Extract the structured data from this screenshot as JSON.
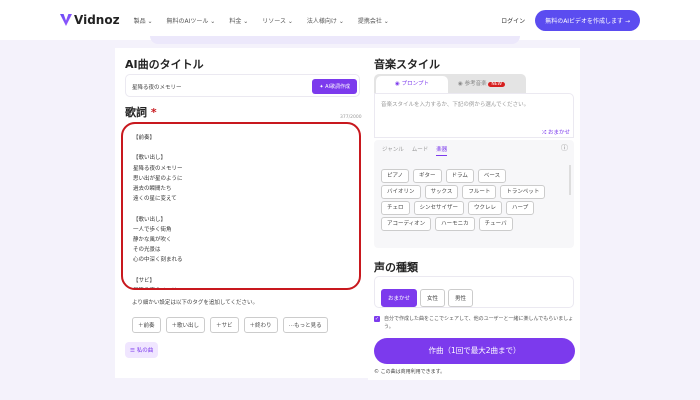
{
  "header": {
    "logo": "Vidnoz",
    "nav": [
      "製品",
      "無料のAIツール",
      "料金",
      "リソース",
      "法人様向け",
      "提携会社"
    ],
    "login": "ログイン",
    "cta": "無料のAIビデオを作成します →"
  },
  "left": {
    "title_heading": "AI曲のタイトル",
    "title_value": "星降る夜のメモリー",
    "ai_lyrics_button": "✦ AI歌詞作成",
    "lyrics_heading": "歌詞",
    "required_mark": "*",
    "counter": "377/2000",
    "lyrics": "【前奏】\n\n【歌い出し】\n星降る夜のメモリー\n思い出が星のように\n過去の瞬間たち\n遠くの星に変えて\n\n【歌い出し】\n一人で歩く街角\n静かな風が吹く\nその光景は\n心の中深く刻まれる\n\n【サビ】\n星降る夜のメモリー",
    "tag_hint": "より細かい設定は以下のタグを追加してください。",
    "tags": [
      "＋前奏",
      "＋歌い出し",
      "＋サビ",
      "＋終わり",
      "⋯もっと見る"
    ],
    "my_songs": "私の曲"
  },
  "right": {
    "style_heading": "音楽スタイル",
    "tabs": [
      "プロンプト",
      "参考音楽"
    ],
    "new_badge": "NEW",
    "style_placeholder": "音楽スタイルを入力するか、下記の例から選んでください。",
    "random": "おまかせ",
    "subtabs": [
      "ジャンル",
      "ムード",
      "楽器"
    ],
    "chips": [
      [
        "ピアノ",
        "ギター",
        "ドラム",
        "ベース"
      ],
      [
        "バイオリン",
        "サックス",
        "フルート",
        "トランペット"
      ],
      [
        "チェロ",
        "シンセサイザー",
        "ウクレレ",
        "ハープ"
      ],
      [
        "アコーディオン",
        "ハーモニカ",
        "チューバ"
      ]
    ],
    "voice_heading": "声の種類",
    "voices": [
      "おまかせ",
      "女性",
      "男性"
    ],
    "share_text": "自分で作成した曲をここでシェアして、他のユーザーと一緒に楽しんでもらいましょう。",
    "share_checked": true,
    "submit": "作曲（1回で最大2曲まで）",
    "note": "この曲は商用利用できます。"
  },
  "colors": {
    "accent": "#7c3aed",
    "annotation": "#c8181e"
  }
}
